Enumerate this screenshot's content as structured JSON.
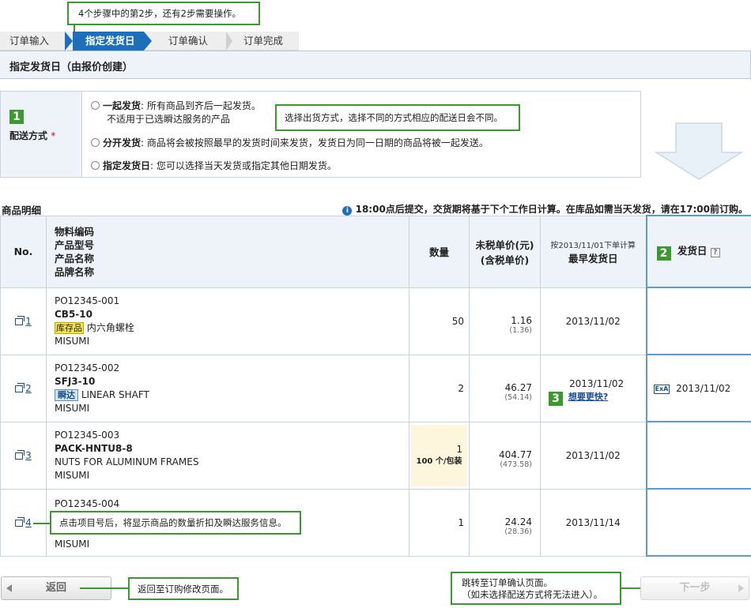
{
  "tips": {
    "step": "4个步骤中的第2步，还有2步需要操作。",
    "shipping": "选择出货方式，选择不同的方式相应的配送日会不同。",
    "item_no": "点击项目号后，将显示商品的数量折扣及瞬达服务信息。",
    "back": "返回至订购修改页面。",
    "next_line1": "跳转至订单确认页面。",
    "next_line2": "（如未选择配送方式将无法进入）。"
  },
  "steps": [
    "订单输入",
    "指定发货日",
    "订单确认",
    "订单完成"
  ],
  "page_title": "指定发货日（由报价创建）",
  "shipping": {
    "badge": "1",
    "label": "配送方式",
    "required": "*",
    "options": [
      {
        "name": "一起发货",
        "desc": ": 所有商品到齐后一起发货。",
        "desc2": "不适用于已选瞬达服务的产品"
      },
      {
        "name": "分开发货",
        "desc": ": 商品将会被按照最早的发货时间来发货，发货日为同一日期的商品将被一起发送。"
      },
      {
        "name": "指定发货日",
        "desc": ": 您可以选择当天发货或指定其他日期发货。"
      }
    ]
  },
  "details": {
    "title": "商品明细",
    "notice": "18:00点后提交，交货期将基于下个工作日计算。在库品如需当天发货，请在17:00前订购。"
  },
  "table": {
    "headers": {
      "no": "No.",
      "product_lines": [
        "物料编码",
        "产品型号",
        "产品名称",
        "品牌名称"
      ],
      "qty": "数量",
      "price_line1": "未税单价(元)",
      "price_line2": "(含税单价)",
      "date_line1": "按2013/11/01下单计算",
      "date_line2": "最早发货日",
      "ship_badge": "2",
      "ship": "发货日",
      "ship_help": "?"
    },
    "rows": [
      {
        "no": "1",
        "code": "PO12345-001",
        "model": "CB5-10",
        "tag": "库存品",
        "name": "内六角螺栓",
        "brand": "MISUMI",
        "qty": "50",
        "price": "1.16",
        "price_tax": "(1.36)",
        "earliest": "2013/11/02",
        "ship_date": ""
      },
      {
        "no": "2",
        "code": "PO12345-002",
        "model": "SFJ3-10",
        "tag": "瞬达",
        "name": "LINEAR SHAFT",
        "brand": "MISUMI",
        "qty": "2",
        "price": "46.27",
        "price_tax": "(54.14)",
        "earliest": "2013/11/02",
        "faster_badge": "3",
        "faster": "想要更快?",
        "ship_icon": "ExA",
        "ship_date": "2013/11/02"
      },
      {
        "no": "3",
        "code": "PO12345-003",
        "model": "PACK-HNTU8-8",
        "tag": "",
        "name": "NUTS FOR ALUMINUM FRAMES",
        "brand": "MISUMI",
        "qty": "1",
        "qty_pack": "100 个/包装",
        "price": "404.77",
        "price_tax": "(473.58)",
        "earliest": "2013/11/02",
        "ship_date": ""
      },
      {
        "no": "4",
        "code": "PO12345-004",
        "model": "",
        "tag": "",
        "name": "",
        "brand": "MISUMI",
        "qty": "1",
        "price": "24.24",
        "price_tax": "(28.36)",
        "earliest": "2013/11/14",
        "ship_date": ""
      }
    ]
  },
  "buttons": {
    "back": "返回",
    "next": "下一步"
  }
}
